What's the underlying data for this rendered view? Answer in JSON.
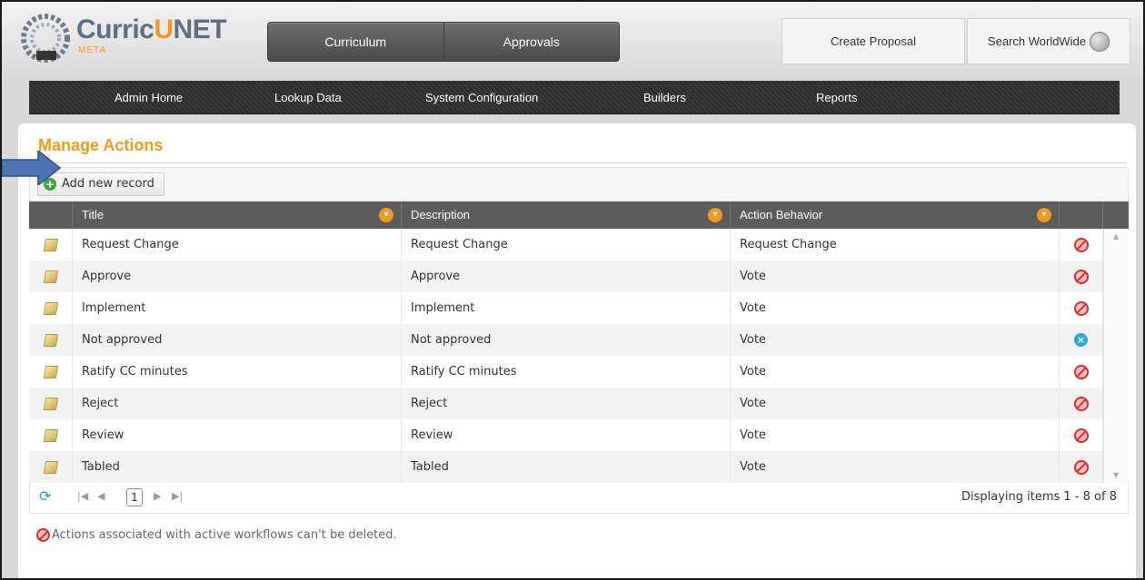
{
  "header": {
    "logo": {
      "part1": "Curric",
      "part2": "U",
      "part3": "NET",
      "sub": "META"
    },
    "nav_tabs": [
      {
        "label": "Curriculum"
      },
      {
        "label": "Approvals"
      }
    ],
    "create_proposal": "Create Proposal",
    "search_worldwide": "Search WorldWide"
  },
  "admin_nav": [
    {
      "label": "Admin Home"
    },
    {
      "label": "Lookup Data"
    },
    {
      "label": "System Configuration"
    },
    {
      "label": "Builders"
    },
    {
      "label": "Reports"
    }
  ],
  "panel": {
    "title": "Manage Actions",
    "add_record": "Add new record"
  },
  "grid": {
    "columns": [
      {
        "label": "Title"
      },
      {
        "label": "Description"
      },
      {
        "label": "Action Behavior"
      }
    ],
    "rows": [
      {
        "title": "Request Change",
        "description": "Request Change",
        "behavior": "Request Change",
        "delete": "blocked"
      },
      {
        "title": "Approve",
        "description": "Approve",
        "behavior": "Vote",
        "delete": "blocked"
      },
      {
        "title": "Implement",
        "description": "Implement",
        "behavior": "Vote",
        "delete": "blocked"
      },
      {
        "title": "Not approved",
        "description": "Not approved",
        "behavior": "Vote",
        "delete": "delete"
      },
      {
        "title": "Ratify CC minutes",
        "description": "Ratify CC minutes",
        "behavior": "Vote",
        "delete": "blocked"
      },
      {
        "title": "Reject",
        "description": "Reject",
        "behavior": "Vote",
        "delete": "blocked"
      },
      {
        "title": "Review",
        "description": "Review",
        "behavior": "Vote",
        "delete": "blocked"
      },
      {
        "title": "Tabled",
        "description": "Tabled",
        "behavior": "Vote",
        "delete": "blocked"
      }
    ]
  },
  "pager": {
    "page": "1",
    "info": "Displaying items 1 - 8 of 8"
  },
  "footnote": "Actions associated with active workflows can't be deleted.",
  "colors": {
    "accent": "#f39a1e",
    "header_grid": "#5c5c5c",
    "blocked": "#e02b2b",
    "delete": "#2aa7df"
  }
}
